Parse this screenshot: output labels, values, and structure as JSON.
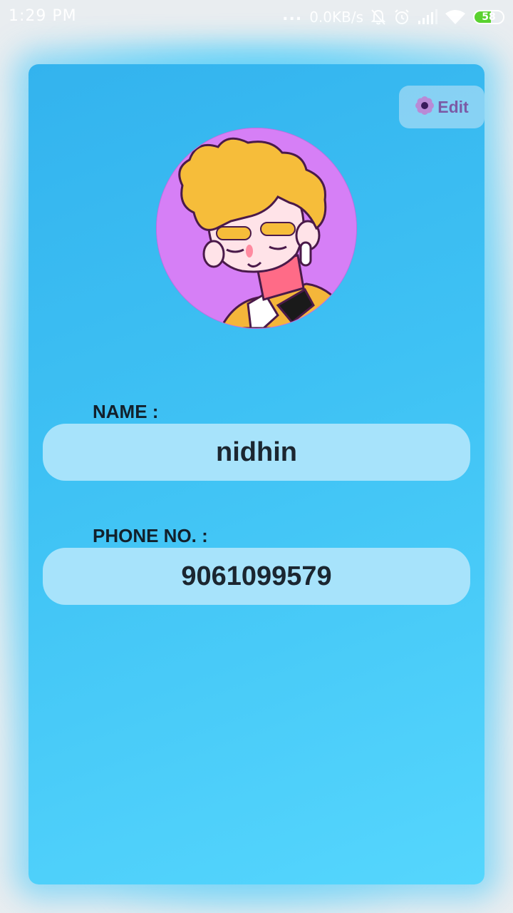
{
  "status_bar": {
    "time": "1:29 PM",
    "dots": "...",
    "network_speed": "0.0KB/s",
    "icons": [
      "bell-off-icon",
      "alarm-icon",
      "signal-icon",
      "wifi-icon",
      "battery-icon"
    ],
    "battery_level": "58",
    "battery_fraction": 0.58
  },
  "profile": {
    "edit_label": "Edit",
    "edit_icon": "flower-icon",
    "avatar_icon": "cartoon-avatar",
    "name_label": "NAME :",
    "name_value": "nidhin",
    "phone_label": "PHONE NO. :",
    "phone_value": "9061099579"
  },
  "colors": {
    "card_top": "#33b3ee",
    "card_bottom": "#55d6fd",
    "field_background": "#a7e3fb",
    "edit_text": "#7b5aa6",
    "avatar_background": "#d67ff6"
  }
}
